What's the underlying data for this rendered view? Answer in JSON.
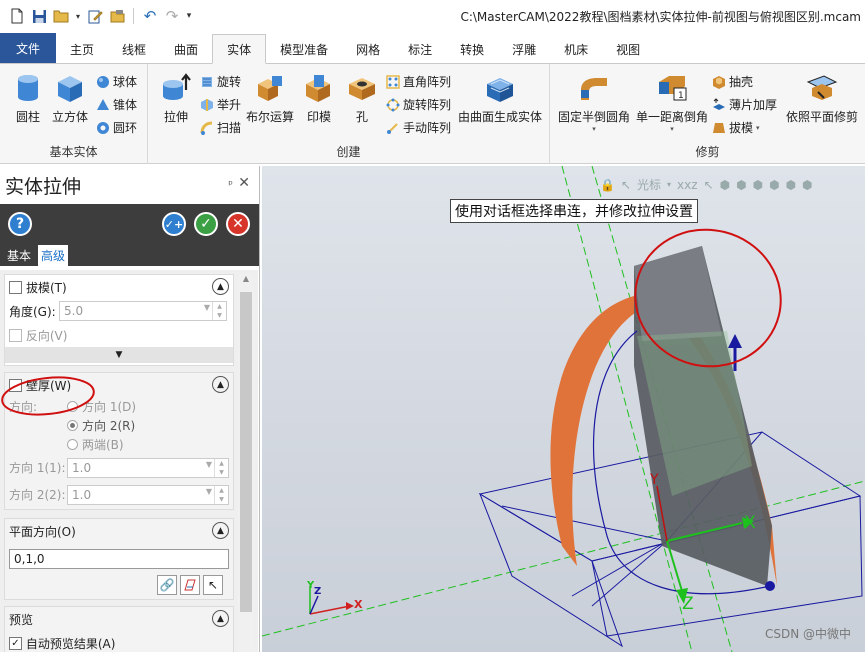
{
  "window": {
    "title": "C:\\MasterCAM\\2022教程\\图档素材\\实体拉伸-前视图与俯视图区别.mcam"
  },
  "tabs": [
    {
      "label": "文件"
    },
    {
      "label": "主页"
    },
    {
      "label": "线框"
    },
    {
      "label": "曲面"
    },
    {
      "label": "实体"
    },
    {
      "label": "模型准备"
    },
    {
      "label": "网格"
    },
    {
      "label": "标注"
    },
    {
      "label": "转换"
    },
    {
      "label": "浮雕"
    },
    {
      "label": "机床"
    },
    {
      "label": "视图"
    }
  ],
  "ribbon": {
    "basic": {
      "label": "基本实体",
      "cylinder": "圆柱",
      "cube": "立方体",
      "sphere": "球体",
      "cone": "锥体",
      "torus": "圆环"
    },
    "create": {
      "label": "创建",
      "extrude": "拉伸",
      "revolve": "旋转",
      "loft": "举升",
      "sweep": "扫描",
      "boolean": "布尔运算",
      "imprint": "印模",
      "hole": "孔",
      "rect_array": "直角阵列",
      "rot_array": "旋转阵列",
      "manual_array": "手动阵列",
      "from_surface": "由曲面生成实体"
    },
    "modify": {
      "label": "修剪",
      "fixed_fillet": "固定半倒圆角",
      "chamfer": "单一距离倒角",
      "shell": "抽壳",
      "thicken": "薄片加厚",
      "draft": "拔模",
      "trim_plane": "依照平面修剪"
    }
  },
  "panel": {
    "title": "实体拉伸",
    "tab_basic": "基本",
    "tab_advanced": "高级",
    "draft": {
      "label": "拔模(T)",
      "angle_label": "角度(G):",
      "angle_value": "5.0",
      "reverse_label": "反向(V)"
    },
    "wall": {
      "label": "壁厚(W)",
      "direction_label": "方向:",
      "dir1": "方向 1(D)",
      "dir2": "方向 2(R)",
      "both": "两端(B)",
      "dir1_field_label": "方向 1(1):",
      "dir1_value": "1.0",
      "dir2_field_label": "方向 2(2):",
      "dir2_value": "1.0"
    },
    "plane": {
      "label": "平面方向(O)",
      "value": "0,1,0"
    },
    "preview": {
      "label": "预览",
      "auto_label": "自动预览结果(A)"
    }
  },
  "viewport": {
    "hint": "使用对话框选择串连，并修改拉伸设置",
    "toolbar_label": "光标",
    "toolbar_xyz": "xxz",
    "axis_x": "X",
    "axis_y": "Y",
    "axis_z": "Z",
    "watermark": "CSDN @中微中"
  },
  "colors": {
    "file_tab": "#2b579a",
    "action_bar": "#3d3d3d",
    "orange_surface": "#e0733a",
    "annotation_red": "#d01010",
    "axis_green": "#1ec01e"
  }
}
